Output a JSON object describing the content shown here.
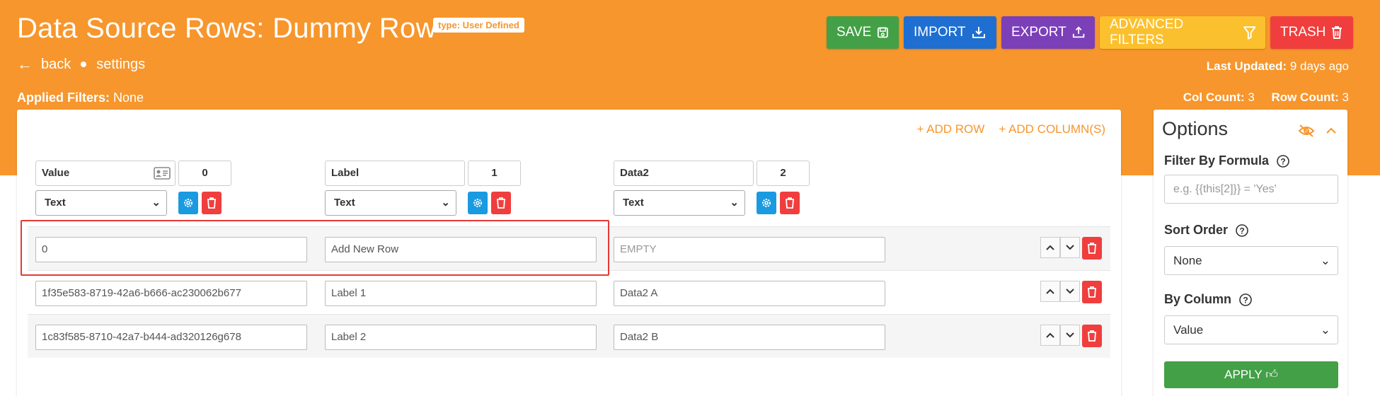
{
  "header": {
    "title": "Data Source Rows: Dummy Row",
    "type_badge": "type: User Defined",
    "back_label": "back",
    "settings_label": "settings",
    "last_updated_label": "Last Updated:",
    "last_updated_value": "9 days ago",
    "applied_filters_label": "Applied Filters:",
    "applied_filters_value": "None",
    "col_count_label": "Col Count:",
    "col_count_value": "3",
    "row_count_label": "Row Count:",
    "row_count_value": "3",
    "bg_color": "#f7962c"
  },
  "toolbar": {
    "save_label": "SAVE",
    "import_label": "IMPORT",
    "export_label": "EXPORT",
    "filters_label": "ADVANCED FILTERS",
    "trash_label": "TRASH"
  },
  "table": {
    "add_row_label": "ADD ROW",
    "add_columns_label": "ADD COLUMN(S)",
    "columns": [
      {
        "name": "Value",
        "index": "0",
        "type": "Text"
      },
      {
        "name": "Label",
        "index": "1",
        "type": "Text"
      },
      {
        "name": "Data2",
        "index": "2",
        "type": "Text"
      }
    ],
    "rows": [
      {
        "cells": [
          "0",
          "Add New Row",
          ""
        ],
        "placeholder": "EMPTY"
      },
      {
        "cells": [
          "1f35e583-8719-42a6-b666-ac230062b677",
          "Label 1",
          "Data2 A"
        ]
      },
      {
        "cells": [
          "1c83f585-8710-42a7-b444-ad320126g678",
          "Label 2",
          "Data2 B"
        ]
      }
    ]
  },
  "options": {
    "title": "Options",
    "filter_label": "Filter By Formula",
    "filter_placeholder": "e.g. {{this[2]}} = 'Yes'",
    "sort_label": "Sort Order",
    "sort_value": "None",
    "by_column_label": "By Column",
    "by_column_value": "Value",
    "apply_label": "APPLY"
  }
}
